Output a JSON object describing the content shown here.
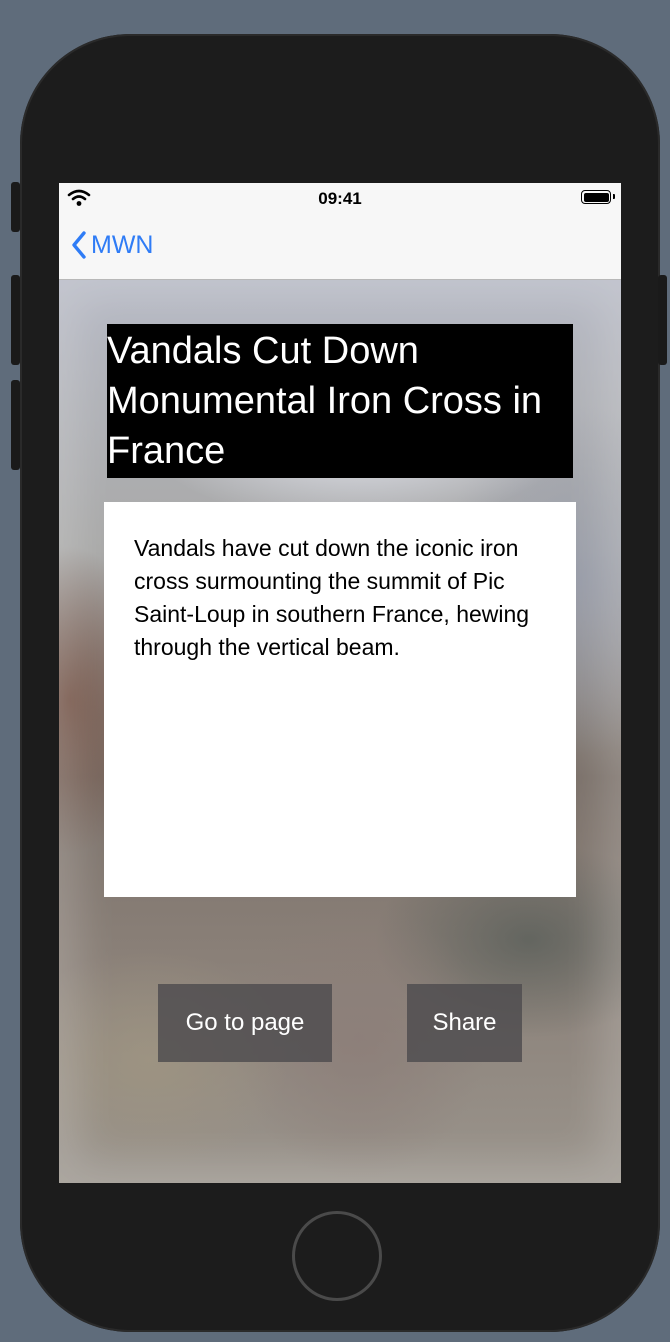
{
  "status_bar": {
    "time": "09:41",
    "wifi_icon": "wifi-icon",
    "battery_icon": "battery-icon"
  },
  "nav": {
    "back_label": "MWN",
    "back_icon": "chevron-left-icon"
  },
  "article": {
    "title": "Vandals Cut Down Monumental Iron Cross in France",
    "summary": "Vandals have cut down the iconic iron cross surmounting the summit of Pic Saint-Loup in southern France, hewing through the vertical beam."
  },
  "actions": {
    "go_to_page_label": "Go to page",
    "share_label": "Share"
  },
  "colors": {
    "accent": "#2f7cf6",
    "device_frame": "#1c1c1c",
    "backdrop": "#5f6c7b"
  }
}
